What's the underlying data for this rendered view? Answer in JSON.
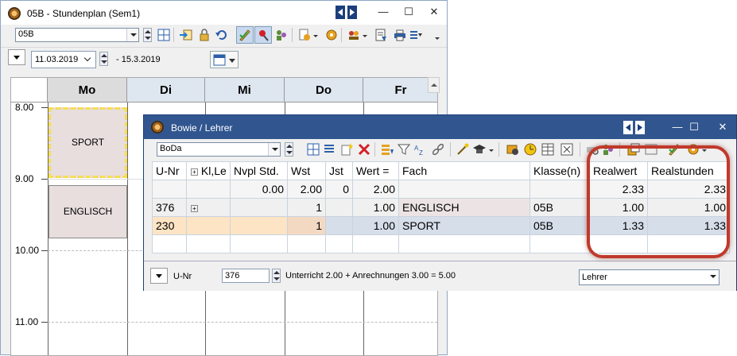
{
  "main_window": {
    "title": "05B  -  Stundenplan  (Sem1)",
    "minimize": "—",
    "maximize": "☐",
    "close": "✕",
    "class_combo_value": "05B",
    "date_from": "11.03.2019",
    "date_to": "- 15.3.2019"
  },
  "timetable": {
    "days": [
      "Mo",
      "Di",
      "Mi",
      "Do",
      "Fr"
    ],
    "hours": [
      "8.00",
      "9.00",
      "10.00",
      "11.00"
    ],
    "lessons": [
      {
        "day": "Mo",
        "label": "SPORT",
        "selected": true
      },
      {
        "day": "Mo",
        "label": "ENGLISCH",
        "selected": false
      }
    ]
  },
  "teacher_window": {
    "title": "Bowie / Lehrer",
    "minimize": "—",
    "maximize": "☐",
    "close": "✕",
    "teacher_combo_value": "BoDa",
    "columns": [
      "U-Nr",
      "Kl,Le",
      "Nvpl Std.",
      "Wst",
      "Jst",
      "Wert =",
      "Fach",
      "Klasse(n)",
      "Realwert",
      "Realstunden"
    ],
    "rows": [
      {
        "unr": "",
        "klle": "",
        "nvpl": "0.00",
        "wst": "2.00",
        "jst": "0",
        "wert": "2.00",
        "fach": "",
        "klasse": "",
        "realwert": "2.33",
        "realstunden": "2.33"
      },
      {
        "unr": "376",
        "klle": "+",
        "nvpl": "",
        "wst": "1",
        "jst": "",
        "wert": "1.00",
        "fach": "ENGLISCH",
        "klasse": "05B",
        "realwert": "1.00",
        "realstunden": "1.00"
      },
      {
        "unr": "230",
        "klle": "",
        "nvpl": "",
        "wst": "1",
        "jst": "",
        "wert": "1.00",
        "fach": "SPORT",
        "klasse": "05B",
        "realwert": "1.33",
        "realstunden": "1.33"
      }
    ],
    "status": {
      "sort_label": "U-Nr",
      "unr_value": "376",
      "summary": "Unterricht 2.00 + Anrechnungen 3.00 = 5.00",
      "view_combo": "Lehrer"
    }
  },
  "colors": {
    "title_active": "#31568f",
    "highlight_ring": "#c0392b",
    "selected_row": "#d6deea",
    "peach_cell": "#fde4c4"
  }
}
